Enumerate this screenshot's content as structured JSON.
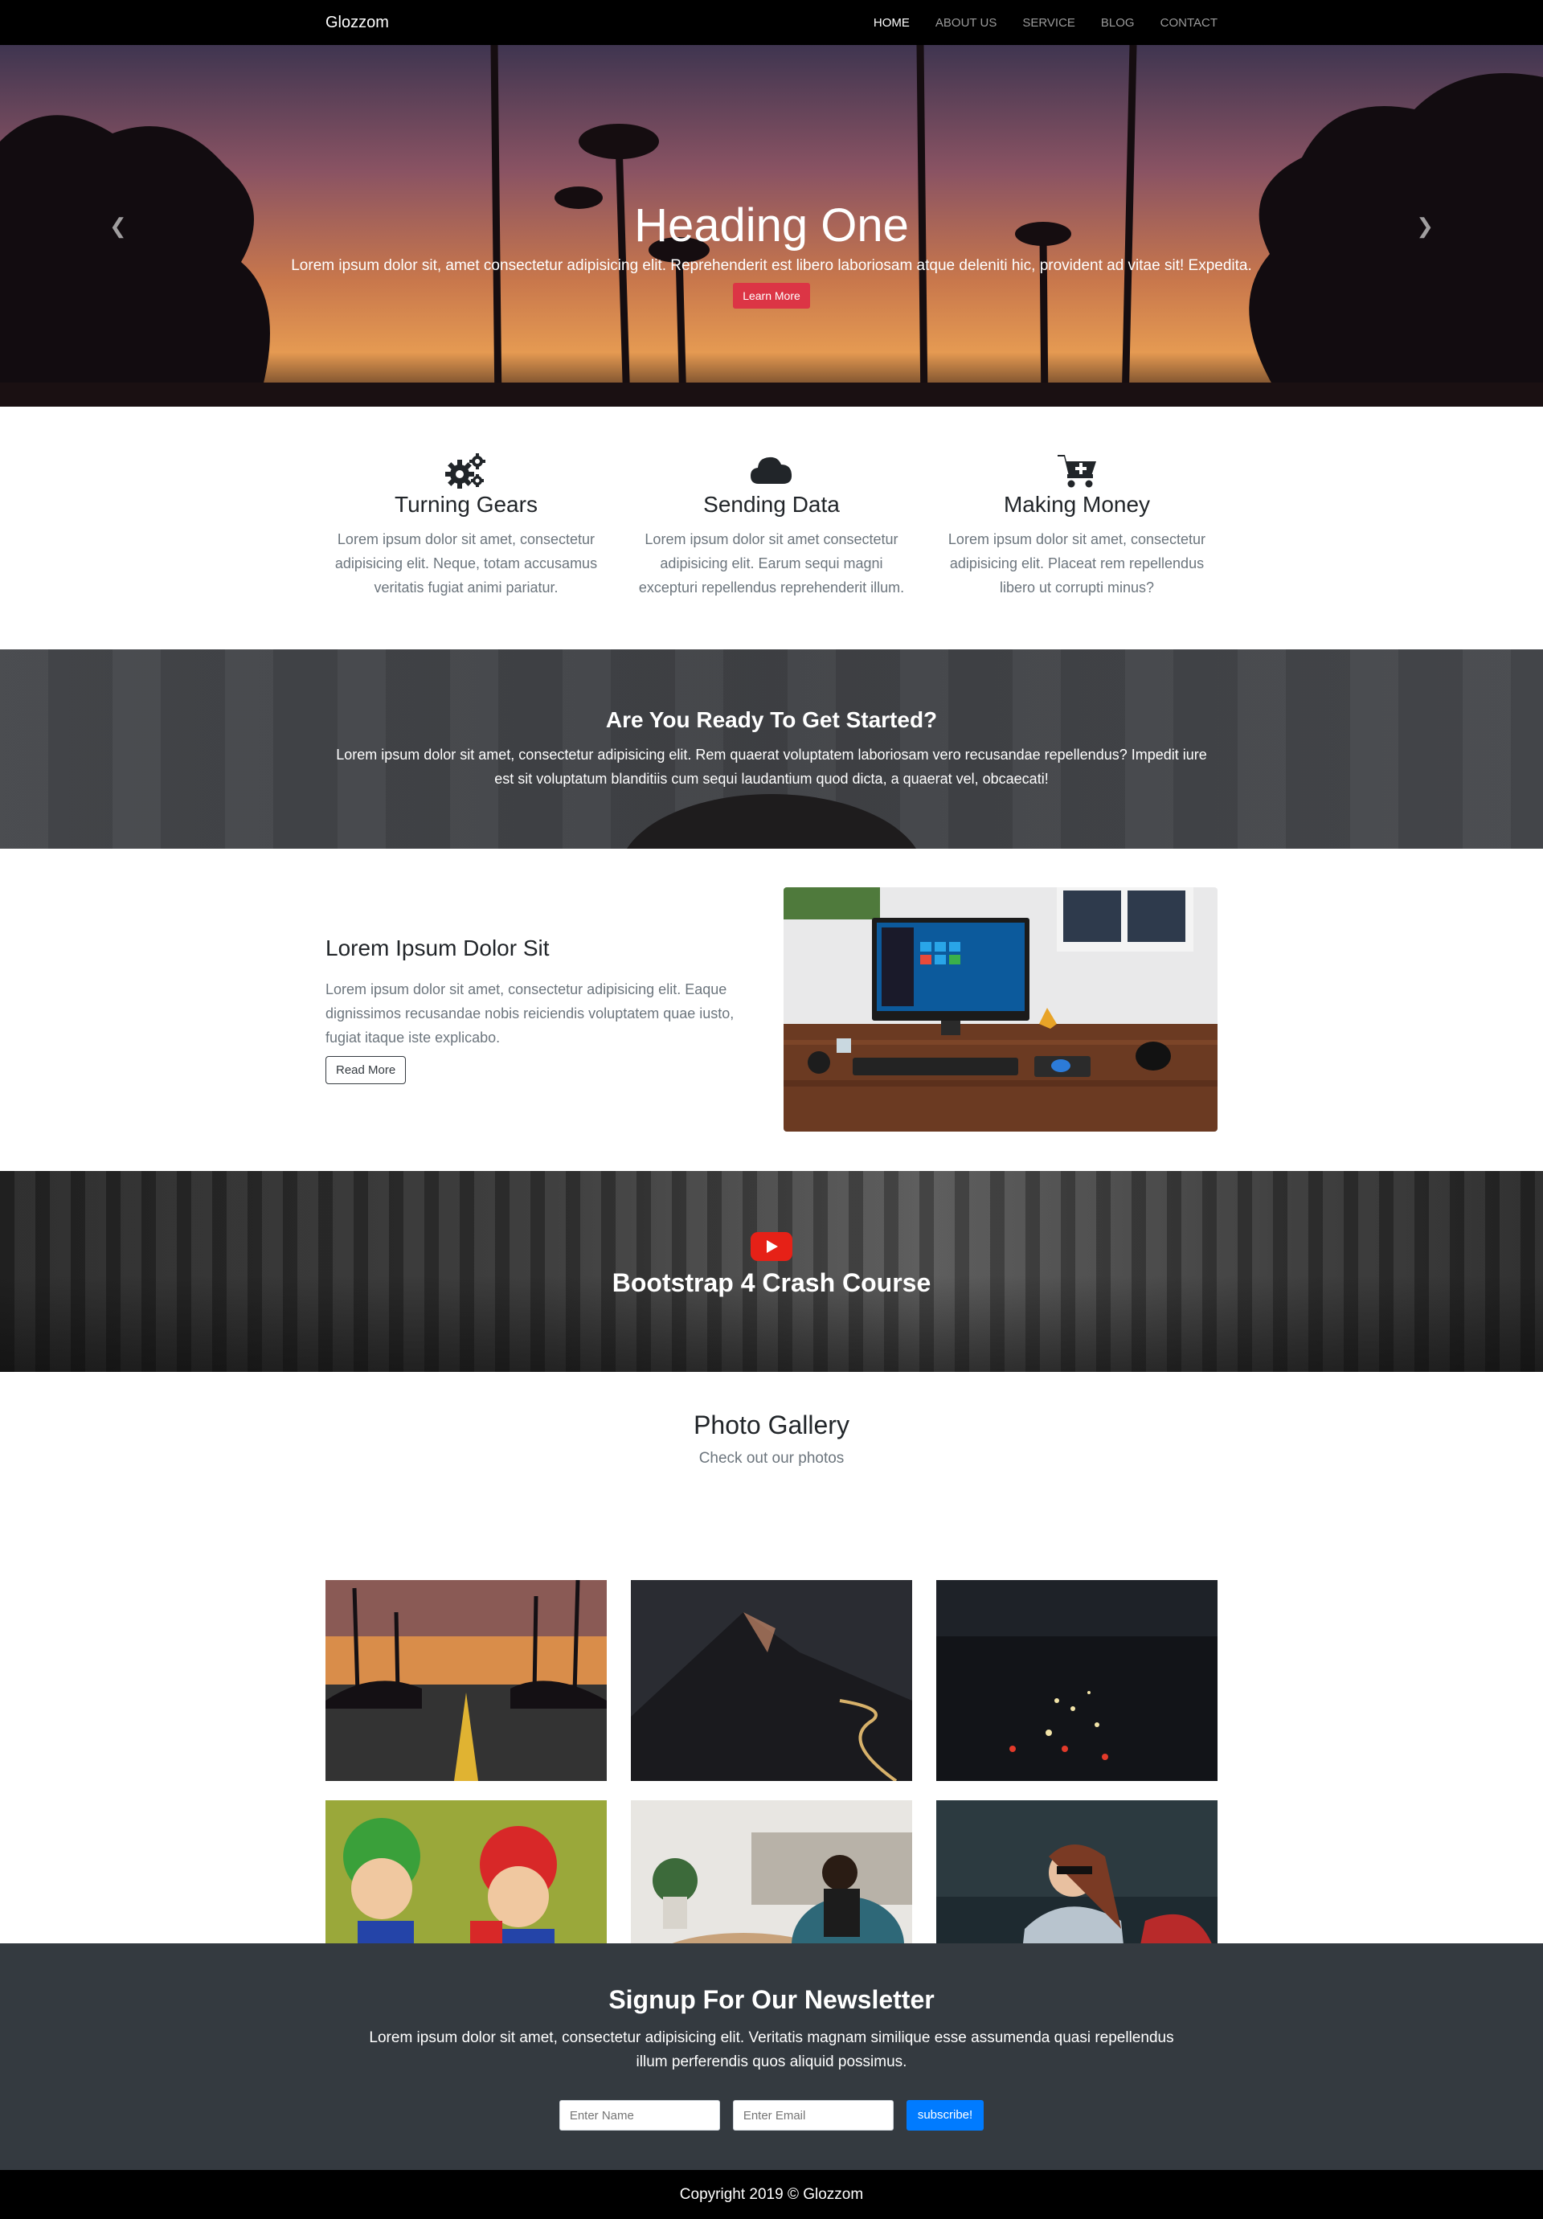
{
  "nav": {
    "brand": "Glozzom",
    "links": [
      {
        "label": "HOME"
      },
      {
        "label": "ABOUT US"
      },
      {
        "label": "SERVICE"
      },
      {
        "label": "BLOG"
      },
      {
        "label": "CONTACT"
      }
    ]
  },
  "hero": {
    "heading": "Heading One",
    "text": "Lorem ipsum dolor sit, amet consectetur adipisicing elit. Reprehenderit est libero laboriosam atque deleniti hic, provident ad vitae sit! Expedita.",
    "button": "Learn More",
    "prev_icon": "chevron-left-icon",
    "next_icon": "chevron-right-icon",
    "indicators": 3,
    "active_indicator": 1
  },
  "features": [
    {
      "icon": "gears-icon",
      "title": "Turning Gears",
      "text": "Lorem ipsum dolor sit amet, consectetur adipisicing elit. Neque, totam accusamus veritatis fugiat animi pariatur."
    },
    {
      "icon": "cloud-icon",
      "title": "Sending Data",
      "text": "Lorem ipsum dolor sit amet consectetur adipisicing elit. Earum sequi magni excepturi repellendus reprehenderit illum."
    },
    {
      "icon": "cart-plus-icon",
      "title": "Making Money",
      "text": "Lorem ipsum dolor sit amet, consectetur adipisicing elit. Placeat rem repellendus libero ut corrupti minus?"
    }
  ],
  "started": {
    "title": "Are You Ready To Get Started?",
    "text": "Lorem ipsum dolor sit amet, consectetur adipisicing elit. Rem quaerat voluptatem laboriosam vero recusandae repellendus? Impedit iure est sit voluptatum blanditiis cum sequi laudantium quod dicta, a quaerat vel, obcaecati!"
  },
  "info": {
    "title": "Lorem Ipsum Dolor Sit",
    "text": "Lorem ipsum dolor sit amet, consectetur adipisicing elit. Eaque dignissimos recusandae nobis reiciendis voluptatem quae iusto, fugiat itaque iste explicabo.",
    "button": "Read More"
  },
  "video": {
    "icon": "youtube-play-icon",
    "title": "Bootstrap 4 Crash Course"
  },
  "gallery": {
    "title": "Photo Gallery",
    "subtitle": "Check out our photos"
  },
  "newsletter": {
    "title": "Signup For Our Newsletter",
    "text": "Lorem ipsum dolor sit amet, consectetur adipisicing elit. Veritatis magnam similique esse assumenda quasi repellendus illum perferendis quos aliquid possimus.",
    "name_placeholder": "Enter Name",
    "email_placeholder": "Enter Email",
    "button": "subscribe!"
  },
  "footer": {
    "copyright": "Copyright 2019 © Glozzom"
  },
  "colors": {
    "danger": "#dc3545",
    "primary": "#007bff",
    "dark": "#343a40"
  }
}
